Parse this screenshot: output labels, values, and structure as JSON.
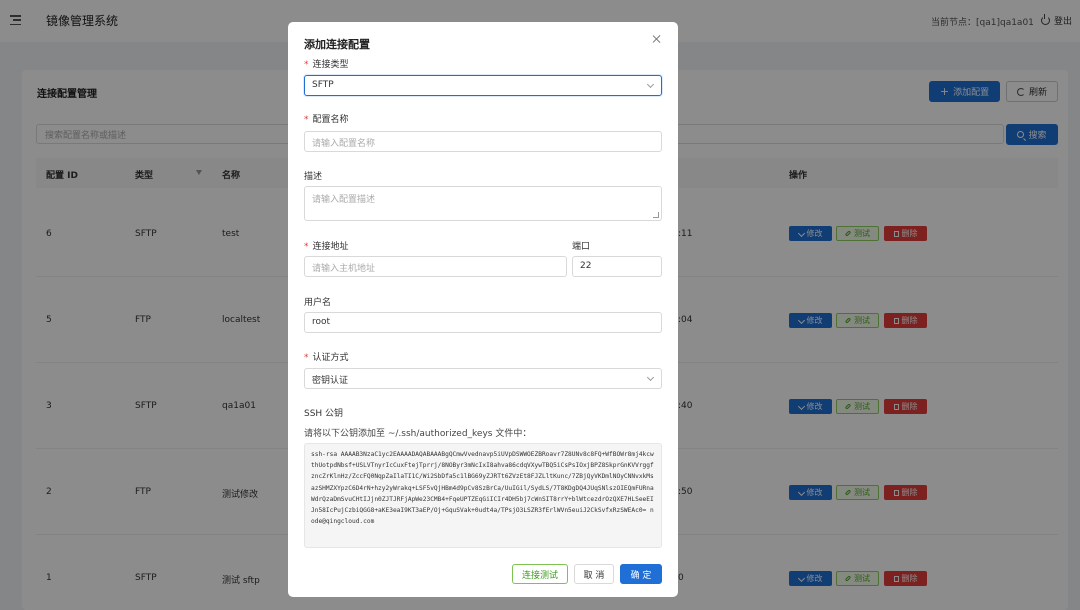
{
  "app": {
    "title": "镜像管理系统",
    "node_label": "当前节点：[qa1]qa1a01",
    "logout_label": "登出"
  },
  "page": {
    "title": "连接配置管理",
    "add_button": "添加配置",
    "refresh_button": "刷新",
    "search_placeholder": "搜索配置名称或描述",
    "search_button": "搜索"
  },
  "table": {
    "columns": [
      "配置 ID",
      "类型",
      "名称",
      "操作"
    ],
    "rows": [
      {
        "id": "6",
        "type": "SFTP",
        "name": "test",
        "frag": ":11"
      },
      {
        "id": "5",
        "type": "FTP",
        "name": "localtest",
        "frag": ":04"
      },
      {
        "id": "3",
        "type": "SFTP",
        "name": "qa1a01",
        "frag": ":40"
      },
      {
        "id": "2",
        "type": "FTP",
        "name": "测试修改",
        "frag": ":50"
      },
      {
        "id": "1",
        "type": "SFTP",
        "name": "测试 sftp",
        "frag": "0"
      }
    ],
    "actions": {
      "edit": "修改",
      "test": "测试",
      "delete": "删除"
    }
  },
  "modal": {
    "title": "添加连接配置",
    "type_label": "连接类型",
    "type_value": "SFTP",
    "name_label": "配置名称",
    "name_placeholder": "请输入配置名称",
    "desc_label": "描述",
    "desc_placeholder": "请输入配置描述",
    "host_label": "连接地址",
    "host_placeholder": "请输入主机地址",
    "port_label": "端口",
    "port_value": "22",
    "user_label": "用户名",
    "user_value": "root",
    "auth_label": "认证方式",
    "auth_value": "密钥认证",
    "ssh_title": "SSH 公钥",
    "ssh_hint": "请将以下公钥添加至 ~/.ssh/authorized_keys 文件中：",
    "ssh_key": "ssh-rsa AAAAB3NzaC1yc2EAAAADAQABAAABgQCmwVvednavp5iUVpDSWWOEZBRoavr7Z8UNv8c8FQ+WfBOWr8mj4kcwthUotpdNbsf+USLVTnyrIcCuxFtejTprrj/8NOByr3mNcIxI8ahva86cdqVXywTBQ5iCsPsIOxjBPZ8SkprGnKVVrggfzncZrKlnHz/ZccFQ0NqpZaIlaTI1C/Wi2SbDfa5c1lBG69yZJRTt6ZVzEt8FJZLltKunc/7ZBjQyVKDmlNOyCNNvxkMsazSHMZXYpzC6D4rN+hzy2yWrakq+LSF5vQjHBm4d9pCv8SzBrCa/UuIGil/SydLS/7T8KDgDQ4JUqSNlszOIEQmFURnaWdrQzaDmSvuCHtIJjn0ZJTJRFjApWe23CMB4+FqeUPTZEqGiICIr4DH5bj7cWnSIT8rrY+blWtcezdrOzQXE7HLSeeEIJn58IcPujCzbiQGG8+aKE3eaI9KT3aEP/Oj+GquSVak+0udt4a/TPsjO3LSZR3fErlWVn5euiJ2CkSvfxRzSWEAc0= node@qingcloud.com",
    "test_button": "连接测试",
    "cancel_button": "取 消",
    "confirm_button": "确 定"
  }
}
